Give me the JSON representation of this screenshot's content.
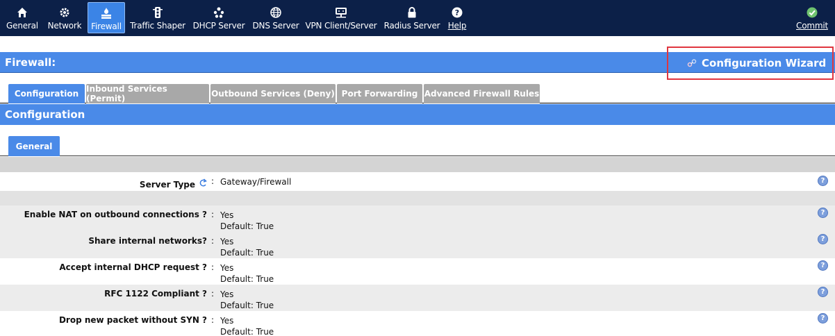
{
  "nav": {
    "items": [
      {
        "label": "General",
        "icon": "home-icon"
      },
      {
        "label": "Network",
        "icon": "gear-icon"
      },
      {
        "label": "Firewall",
        "icon": "firewall-icon"
      },
      {
        "label": "Traffic Shaper",
        "icon": "traffic-light-icon"
      },
      {
        "label": "DHCP Server",
        "icon": "network-nodes-icon"
      },
      {
        "label": "DNS Server",
        "icon": "globe-icon"
      },
      {
        "label": "VPN Client/Server",
        "icon": "monitor-network-icon"
      },
      {
        "label": "Radius Server",
        "icon": "lock-icon"
      },
      {
        "label": "Help",
        "icon": "question-icon"
      }
    ],
    "commit_label": "Commit"
  },
  "header": {
    "title": "Firewall:",
    "wizard_label": "Configuration Wizard"
  },
  "tabs": [
    {
      "label": "Configuration"
    },
    {
      "label": "Inbound Services (Permit)"
    },
    {
      "label": "Outbound Services (Deny)"
    },
    {
      "label": "Port Forwarding"
    },
    {
      "label": "Advanced Firewall Rules"
    }
  ],
  "section": {
    "title": "Configuration",
    "subtab": "General"
  },
  "rows": [
    {
      "label": "Server Type",
      "value": "Gateway/Firewall",
      "default": ""
    },
    {
      "label": "Enable NAT on outbound connections ?",
      "value": "Yes",
      "default": "Default: True"
    },
    {
      "label": "Share internal networks?",
      "value": "Yes",
      "default": "Default: True"
    },
    {
      "label": "Accept internal DHCP request ?",
      "value": "Yes",
      "default": "Default: True"
    },
    {
      "label": "RFC 1122 Compliant ?",
      "value": "Yes",
      "default": "Default: True"
    },
    {
      "label": "Drop new packet without SYN ?",
      "value": "Yes",
      "default": "Default: True"
    }
  ],
  "colon": ":",
  "help_glyph": "?",
  "colors": {
    "nav_bg": "#0c2048",
    "accent": "#4a8ae8",
    "tab_inactive": "#a8a8a8",
    "highlight_box": "#e0353f",
    "commit_green": "#5cb85c"
  }
}
